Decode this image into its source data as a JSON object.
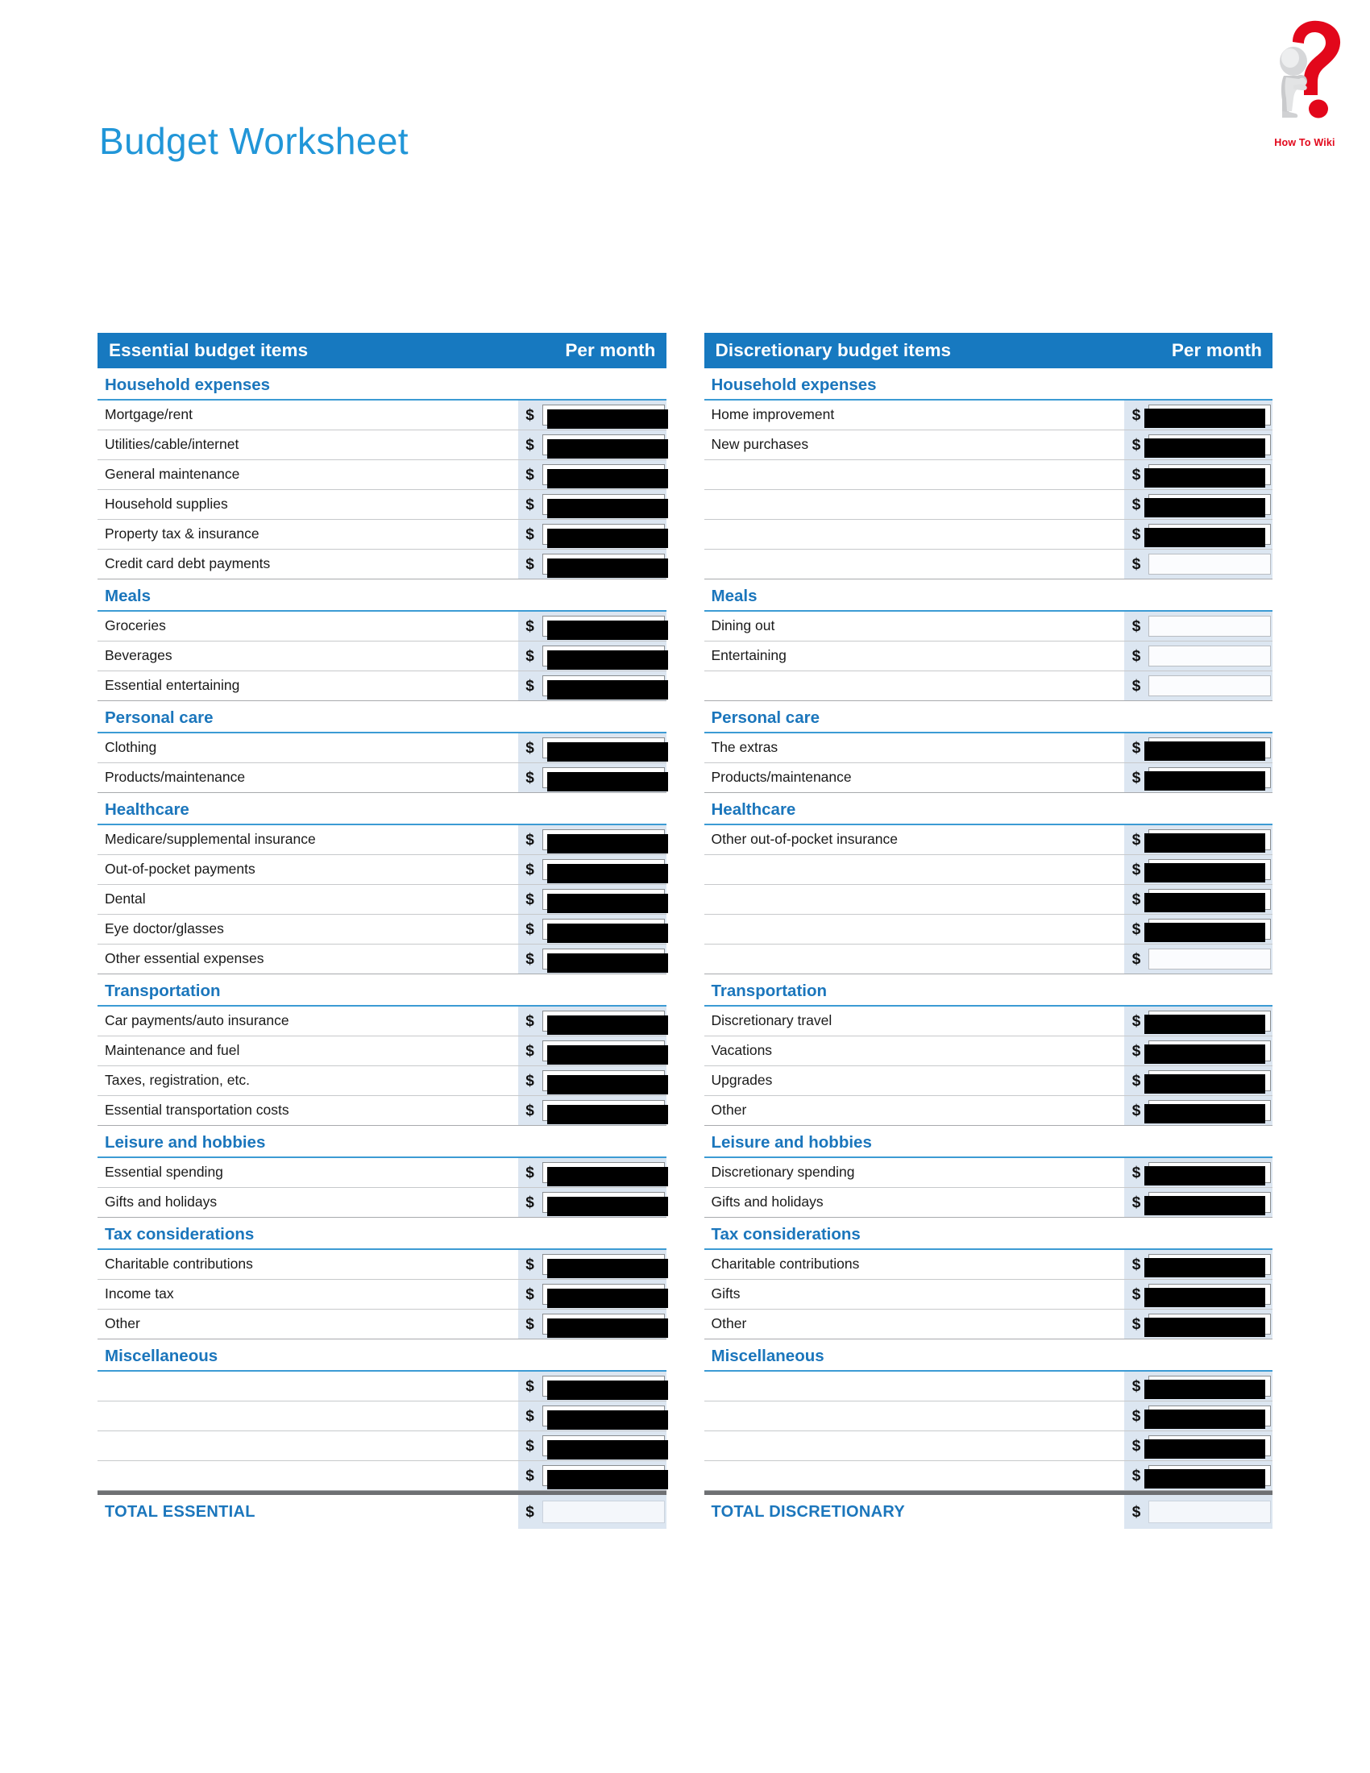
{
  "page": {
    "title": "Budget Worksheet"
  },
  "logo": {
    "caption": "How To Wiki",
    "mark_icon": "question-mark-figure-icon",
    "mark_color": "#E2071B"
  },
  "colors": {
    "header_blue": "#1779C0",
    "section_blue": "#1B76BC",
    "title_blue": "#2196D8",
    "money_cell": "#DCE6F1",
    "rule_gray": "#A8AAAD",
    "total_separator": "#6E7073"
  },
  "columns": [
    {
      "id": "essential",
      "header": {
        "title": "Essential budget items",
        "per_month": "Per month"
      },
      "sections": [
        {
          "name": "Household expenses",
          "rows": [
            {
              "label": "Mortgage/rent",
              "amount": "",
              "box": "shadow-r"
            },
            {
              "label": "Utilities/cable/internet",
              "amount": "",
              "box": "shadow-r"
            },
            {
              "label": "General maintenance",
              "amount": "",
              "box": "shadow-r"
            },
            {
              "label": "Household supplies",
              "amount": "",
              "box": "shadow-r"
            },
            {
              "label": "Property tax & insurance",
              "amount": "",
              "box": "shadow-r"
            },
            {
              "label": "Credit card debt payments",
              "amount": "",
              "box": "shadow-r"
            }
          ]
        },
        {
          "name": "Meals",
          "rows": [
            {
              "label": "Groceries",
              "amount": "",
              "box": "shadow-r"
            },
            {
              "label": "Beverages",
              "amount": "",
              "box": "shadow-r"
            },
            {
              "label": "Essential entertaining",
              "amount": "",
              "box": "shadow-r"
            }
          ]
        },
        {
          "name": "Personal care",
          "rows": [
            {
              "label": "Clothing",
              "amount": "",
              "box": "shadow-r"
            },
            {
              "label": "Products/maintenance",
              "amount": "",
              "box": "shadow-r"
            }
          ]
        },
        {
          "name": "Healthcare",
          "rows": [
            {
              "label": "Medicare/supplemental insurance",
              "amount": "",
              "box": "shadow-r"
            },
            {
              "label": "Out-of-pocket payments",
              "amount": "",
              "box": "shadow-r"
            },
            {
              "label": "Dental",
              "amount": "",
              "box": "shadow-r"
            },
            {
              "label": "Eye doctor/glasses",
              "amount": "",
              "box": "shadow-r"
            },
            {
              "label": "Other essential expenses",
              "amount": "",
              "box": "shadow-r"
            }
          ]
        },
        {
          "name": "Transportation",
          "rows": [
            {
              "label": "Car payments/auto insurance",
              "amount": "",
              "box": "shadow-r"
            },
            {
              "label": "Maintenance and fuel",
              "amount": "",
              "box": "shadow-r"
            },
            {
              "label": "Taxes, registration, etc.",
              "amount": "",
              "box": "shadow-r"
            },
            {
              "label": "Essential transportation costs",
              "amount": "",
              "box": "shadow-r"
            }
          ]
        },
        {
          "name": "Leisure and hobbies",
          "rows": [
            {
              "label": "Essential spending",
              "amount": "",
              "box": "shadow-r"
            },
            {
              "label": "Gifts and holidays",
              "amount": "",
              "box": "shadow-r"
            }
          ]
        },
        {
          "name": "Tax considerations",
          "rows": [
            {
              "label": "Charitable contributions",
              "amount": "",
              "box": "shadow-r"
            },
            {
              "label": "Income tax",
              "amount": "",
              "box": "shadow-r"
            },
            {
              "label": "Other",
              "amount": "",
              "box": "shadow-r"
            }
          ]
        },
        {
          "name": "Miscellaneous",
          "rows": [
            {
              "label": "",
              "amount": "",
              "box": "shadow-r"
            },
            {
              "label": "",
              "amount": "",
              "box": "shadow-r"
            },
            {
              "label": "",
              "amount": "",
              "box": "shadow-r"
            },
            {
              "label": "",
              "amount": "",
              "box": "shadow-r"
            }
          ]
        }
      ],
      "total": {
        "label": "TOTAL ESSENTIAL",
        "currency": "$",
        "amount": ""
      }
    },
    {
      "id": "discretionary",
      "header": {
        "title": "Discretionary budget items",
        "per_month": "Per month"
      },
      "sections": [
        {
          "name": "Household expenses",
          "rows": [
            {
              "label": "Home improvement",
              "amount": "",
              "box": "shadow-l"
            },
            {
              "label": "New purchases",
              "amount": "",
              "box": "shadow-l"
            },
            {
              "label": "",
              "amount": "",
              "box": "shadow-l"
            },
            {
              "label": "",
              "amount": "",
              "box": "shadow-l"
            },
            {
              "label": "",
              "amount": "",
              "box": "shadow-l"
            },
            {
              "label": "",
              "amount": "",
              "box": "flat"
            }
          ]
        },
        {
          "name": "Meals",
          "rows": [
            {
              "label": "Dining out",
              "amount": "",
              "box": "flat"
            },
            {
              "label": "Entertaining",
              "amount": "",
              "box": "flat"
            },
            {
              "label": "",
              "amount": "",
              "box": "flat"
            }
          ]
        },
        {
          "name": "Personal care",
          "rows": [
            {
              "label": "The extras",
              "amount": "",
              "box": "shadow-l"
            },
            {
              "label": "Products/maintenance",
              "amount": "",
              "box": "shadow-l"
            }
          ]
        },
        {
          "name": "Healthcare",
          "rows": [
            {
              "label": "Other out-of-pocket insurance",
              "amount": "",
              "box": "shadow-l"
            },
            {
              "label": "",
              "amount": "",
              "box": "shadow-l"
            },
            {
              "label": "",
              "amount": "",
              "box": "shadow-l"
            },
            {
              "label": "",
              "amount": "",
              "box": "shadow-l"
            },
            {
              "label": "",
              "amount": "",
              "box": "flat"
            }
          ]
        },
        {
          "name": "Transportation",
          "rows": [
            {
              "label": "Discretionary travel",
              "amount": "",
              "box": "shadow-l"
            },
            {
              "label": "Vacations",
              "amount": "",
              "box": "shadow-l"
            },
            {
              "label": "Upgrades",
              "amount": "",
              "box": "shadow-l"
            },
            {
              "label": "Other",
              "amount": "",
              "box": "shadow-l"
            }
          ]
        },
        {
          "name": "Leisure and hobbies",
          "rows": [
            {
              "label": "Discretionary spending",
              "amount": "",
              "box": "shadow-l"
            },
            {
              "label": "Gifts and holidays",
              "amount": "",
              "box": "shadow-l"
            }
          ]
        },
        {
          "name": "Tax considerations",
          "rows": [
            {
              "label": "Charitable contributions",
              "amount": "",
              "box": "shadow-l"
            },
            {
              "label": "Gifts",
              "amount": "",
              "box": "shadow-l"
            },
            {
              "label": "Other",
              "amount": "",
              "box": "shadow-l"
            }
          ]
        },
        {
          "name": "Miscellaneous",
          "rows": [
            {
              "label": "",
              "amount": "",
              "box": "shadow-l"
            },
            {
              "label": "",
              "amount": "",
              "box": "shadow-l"
            },
            {
              "label": "",
              "amount": "",
              "box": "shadow-l"
            },
            {
              "label": "",
              "amount": "",
              "box": "shadow-l"
            }
          ]
        }
      ],
      "total": {
        "label": "TOTAL DISCRETIONARY",
        "currency": "$",
        "amount": ""
      }
    }
  ],
  "currency_symbol": "$"
}
